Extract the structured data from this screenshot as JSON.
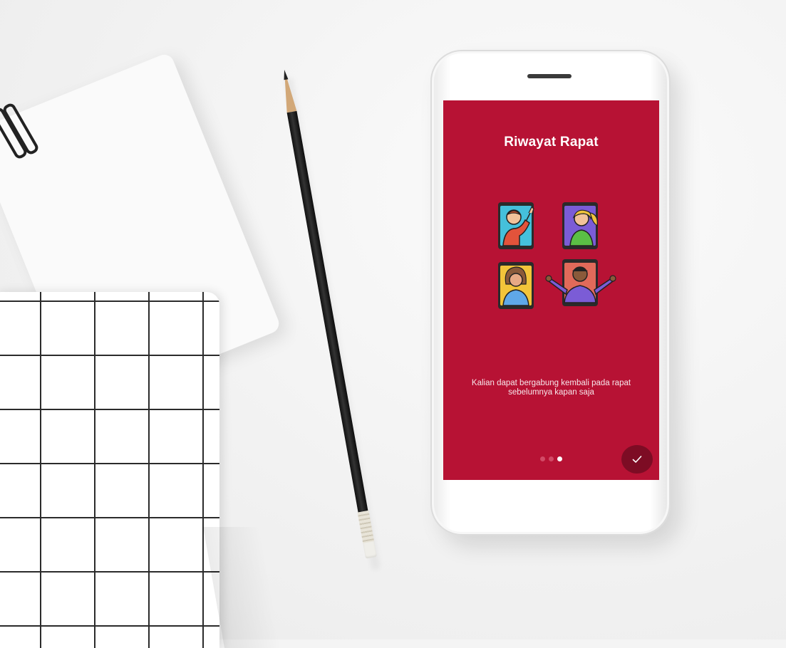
{
  "onboarding": {
    "title": "Riwayat Rapat",
    "description": "Kalian dapat bergabung kembali pada rapat sebelumnya kapan saja",
    "page_indicator": {
      "total": 3,
      "current": 3
    },
    "done_button_icon": "check-icon",
    "illustration_icon": "video-call-people-illustration"
  },
  "colors": {
    "screen_background": "#b71234",
    "done_button": "#7d0c24",
    "dot_inactive": "#d24a66",
    "dot_active": "#ffffff",
    "text": "#ffffff"
  }
}
